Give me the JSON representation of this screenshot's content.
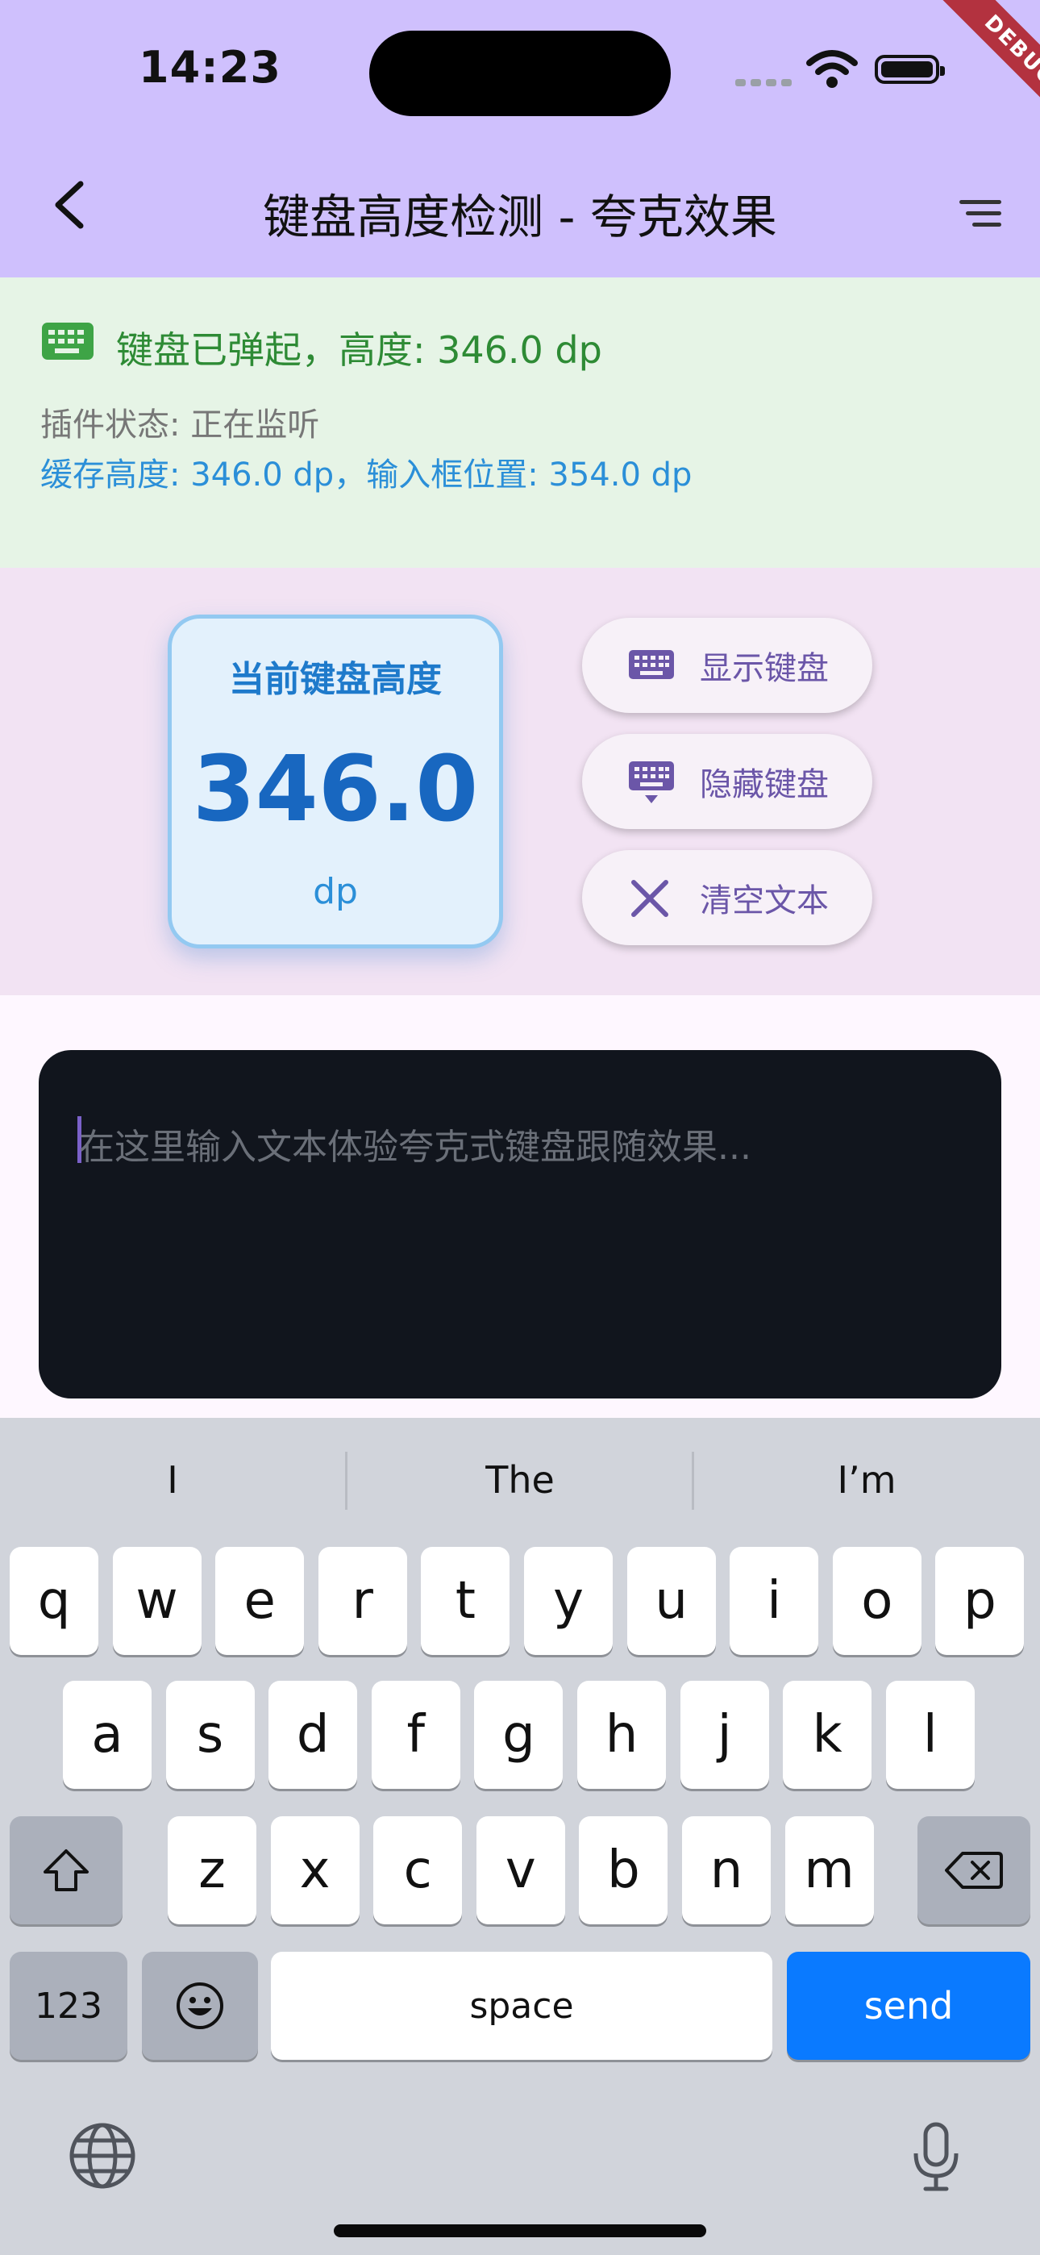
{
  "status_bar": {
    "time": "14:23",
    "debug_banner": "DEBUG"
  },
  "app_bar": {
    "title": "键盘高度检测 - 夸克效果"
  },
  "status_panel": {
    "keyboard_status": "键盘已弹起，高度: 346.0 dp",
    "plugin_status": "插件状态: 正在监听",
    "cache_info": "缓存高度: 346.0 dp，输入框位置: 354.0 dp"
  },
  "height_card": {
    "label": "当前键盘高度",
    "value": "346.0",
    "unit": "dp"
  },
  "actions": {
    "show_keyboard": "显示键盘",
    "hide_keyboard": "隐藏键盘",
    "clear_text": "清空文本"
  },
  "text_input": {
    "value": "",
    "placeholder": "在这里输入文本体验夸克式键盘跟随效果..."
  },
  "keyboard": {
    "suggestions": [
      "I",
      "The",
      "I’m"
    ],
    "row1": [
      "q",
      "w",
      "e",
      "r",
      "t",
      "y",
      "u",
      "i",
      "o",
      "p"
    ],
    "row2": [
      "a",
      "s",
      "d",
      "f",
      "g",
      "h",
      "j",
      "k",
      "l"
    ],
    "row3": [
      "z",
      "x",
      "c",
      "v",
      "b",
      "n",
      "m"
    ],
    "numbers_label": "123",
    "space_label": "space",
    "send_label": "send"
  },
  "colors": {
    "app_bar": "#cfc0fd",
    "status_green": "#2e8b35",
    "accent_blue": "#1867c0",
    "send_key": "#0a7aff"
  }
}
